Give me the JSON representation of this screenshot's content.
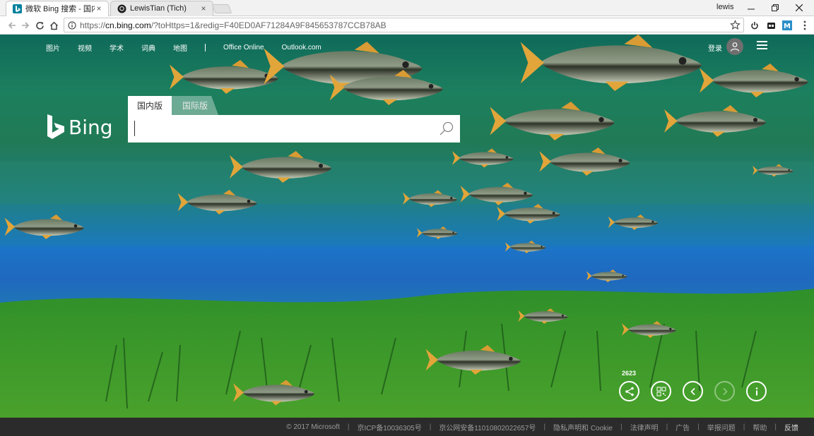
{
  "browser": {
    "tabs": [
      {
        "title": "微软 Bing 搜索 - 国内版",
        "close": "×"
      },
      {
        "title": "LewisTian (Tich)",
        "close": "×"
      }
    ],
    "window_user": "lewis",
    "address": {
      "scheme": "https://",
      "host": "cn.bing.com",
      "path": "/?toHttps=1&redig=F40ED0AF71284A9F845653787CCB78AB"
    }
  },
  "page": {
    "nav": [
      "图片",
      "视频",
      "学术",
      "词典",
      "地图"
    ],
    "nav_extra": [
      "Office Online",
      "Outlook.com"
    ],
    "login": "登录",
    "logo_word": "Bing",
    "scope_tabs": [
      "国内版",
      "国际版"
    ],
    "search_value": "",
    "image_count": "2623",
    "accent_color": "#ffffff"
  },
  "footer": {
    "items": [
      "© 2017 Microsoft",
      "京ICP备10036305号",
      "京公网安备11010802022657号",
      "隐私声明和 Cookie",
      "法律声明",
      "广告",
      "举报问题",
      "帮助",
      "反馈"
    ],
    "separator": "|"
  },
  "icons": {
    "controls": [
      "share-icon",
      "qr-code-icon",
      "previous-icon",
      "next-icon",
      "info-icon"
    ]
  }
}
